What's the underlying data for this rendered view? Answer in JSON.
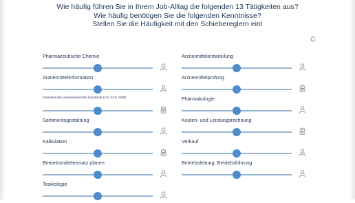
{
  "header": {
    "line1": "Wie häufig führen Sie in Ihrem Job-Alltag die folgenden 13 Tätigkeiten aus?",
    "line2": "Wie häufig benötigen Sie die folgenden Kenntnisse?",
    "line3": "Stellen Sie die Häufigkeit mit den Schiebereglern ein!"
  },
  "reset_icon": "refresh-icon",
  "colors": {
    "text": "#1f3554",
    "track": "#97b4d0",
    "thumb": "#4f8cc9",
    "icon": "#8a8a8a"
  },
  "sliders": [
    {
      "label": "Pharmazeutische Chemie",
      "value": 0.5,
      "icon": "person-icon"
    },
    {
      "label": "Arzneimittelentwicklung",
      "value": 0.5,
      "icon": "person-icon"
    },
    {
      "label": "Arzneimittelinformation",
      "value": 0.5,
      "icon": "person-icon"
    },
    {
      "label": "Arzneimittelprüfung",
      "value": 0.5,
      "icon": "robot-icon"
    },
    {
      "label": "Internationale pharmazeutische Standards (z.B. GLP, GMP)",
      "value": 0.5,
      "icon": "robot-icon"
    },
    {
      "label": "Pharmakologie",
      "value": 0.5,
      "icon": "person-icon"
    },
    {
      "label": "Sortimentsgestaltung",
      "value": 0.5,
      "icon": "person-icon"
    },
    {
      "label": "Kosten- und Leistungsrechnung",
      "value": 0.5,
      "icon": "robot-icon"
    },
    {
      "label": "Kalkulation",
      "value": 0.5,
      "icon": "robot-icon"
    },
    {
      "label": "Verkauf",
      "value": 0.5,
      "icon": "person-icon"
    },
    {
      "label": "Betriebsmitteleinsatz planen",
      "value": 0.5,
      "icon": "person-icon"
    },
    {
      "label": "Betriebsleitung, Betriebsführung",
      "value": 0.5,
      "icon": "person-icon"
    },
    {
      "label": "Toxikologie",
      "value": 0.5,
      "icon": "person-icon"
    }
  ]
}
